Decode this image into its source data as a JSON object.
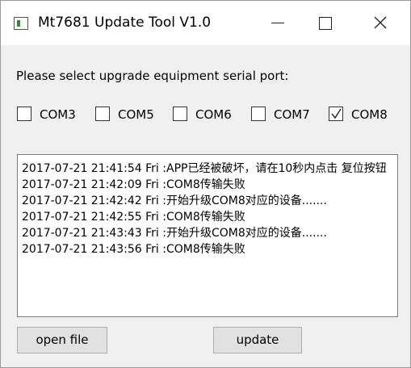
{
  "window": {
    "title": "Mt7681 Update Tool V1.0",
    "app_icon": "app-icon",
    "controls": [
      "minimize-icon",
      "maximize-icon",
      "close-icon"
    ]
  },
  "prompt": "Please select upgrade equipment serial port:",
  "ports": [
    {
      "label": "COM3",
      "checked": false
    },
    {
      "label": "COM5",
      "checked": false
    },
    {
      "label": "COM6",
      "checked": false
    },
    {
      "label": "COM7",
      "checked": false
    },
    {
      "label": "COM8",
      "checked": true
    }
  ],
  "log": [
    "2017-07-21 21:41:54 Fri :APP已经被破坏，请在10秒内点击 复位按钮",
    "2017-07-21 21:42:09 Fri :COM8传输失败",
    "2017-07-21 21:42:42 Fri :开始升级COM8对应的设备.......",
    "2017-07-21 21:42:55 Fri :COM8传输失败",
    "2017-07-21 21:43:43 Fri :开始升级COM8对应的设备.......",
    "2017-07-21 21:43:56 Fri :COM8传输失败"
  ],
  "buttons": {
    "open_file": "open file",
    "update": "update"
  }
}
